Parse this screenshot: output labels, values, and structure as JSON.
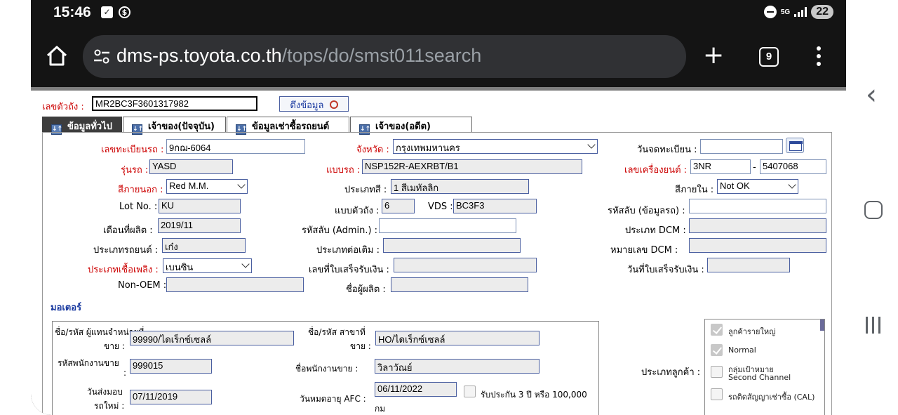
{
  "status": {
    "time": "15:46",
    "network": "5G",
    "battery": "22"
  },
  "browser": {
    "url_host": "dms-ps.toyota.co.th",
    "url_path": "/tops/do/smst011search",
    "tab_count": "9"
  },
  "header": {
    "vin_label": "เลขตัวถัง :",
    "vin_value": "MR2BC3F3601317982",
    "fetch_label": "ดึงข้อมูล"
  },
  "tabs": [
    {
      "label": "ข้อมูลทั่วไป"
    },
    {
      "label": "เจ้าของ(ปัจจุบัน)"
    },
    {
      "label": "ข้อมูลเช่าซื้อรถยนต์"
    },
    {
      "label": "เจ้าของ(อดีต)"
    }
  ],
  "fields": {
    "plate_label": "เลขทะเบียนรถ :",
    "plate_value": "9กฌ-6064",
    "province_label": "จังหวัด :",
    "province_value": "กรุงเทพมหานคร",
    "regdate_label": "วันจดทะเบียน :",
    "regdate_value": "",
    "model_label": "รุ่นรถ :",
    "model_value": "YASD",
    "type_label": "แบบรถ :",
    "type_value": "NSP152R-AEXRBT/B1",
    "engine_label": "เลขเครื่องยนต์ :",
    "engine_prefix": "3NR",
    "engine_dash": "-",
    "engine_value": "5407068",
    "extcolor_label": "สีภายนอก :",
    "extcolor_value": "Red M.M.",
    "colortype_label": "ประเภทสี :",
    "colortype_value": "1 สีเมทัลลิก",
    "intcolor_label": "สีภายใน :",
    "intcolor_value": "Not OK",
    "lot_label": "Lot No. :",
    "lot_value": "KU",
    "body_label": "แบบตัวถัง :",
    "body_value": "6",
    "vds_label": "VDS :",
    "vds_value": "BC3F3",
    "secret_label": "รหัสลับ (ข้อมูลรถ) :",
    "secret_value": "",
    "mfgmonth_label": "เดือนที่ผลิต :",
    "mfgmonth_value": "2019/11",
    "admin_label": "รหัสลับ (Admin.) :",
    "admin_value": "",
    "dcmtype_label": "ประเภท DCM :",
    "dcmtype_value": "",
    "cartype_label": "ประเภทรถยนต์ :",
    "cartype_value": "เก๋ง",
    "extension_label": "ประเภทต่อเติม :",
    "extension_value": "",
    "dcmno_label": "หมายเลข DCM :",
    "dcmno_value": "",
    "fuel_label": "ประเภทเชื้อเพลิง :",
    "fuel_value": "เบนซิน",
    "receipt_label": "เลขที่ใบเสร็จรับเงิน :",
    "receipt_value": "",
    "receiptdate_label": "วันที่ใบเสร็จรับเงิน :",
    "receiptdate_value": "",
    "nonoem_label": "Non-OEM :",
    "nonoem_value": "",
    "maker_label": "ชื่อผู้ผลิต :",
    "maker_value": ""
  },
  "motor": {
    "section_title": "มอเตอร์",
    "dealer_label_1": "ชื่อ/รหัส ผู้แทนจำหน่ายที่",
    "dealer_label_2": "ขาย :",
    "dealer_value": "99990/ไดเร็กซ์เซลล์",
    "branch_label_1": "ชื่อ/รหัส สาขาที่",
    "branch_label_2": "ขาย :",
    "branch_value": "HO/ไดเร็กซ์เซลล์",
    "staffcode_label_1": "รหัสพนักงานขาย",
    "staffcode_label_2": ":",
    "staffcode_value": "999015",
    "staffname_label": "ชื่อพนักงานขาย :",
    "staffname_value": "วิลาวัณย์",
    "delivery_label_1": "วันส่งมอบ",
    "delivery_label_2": "รถใหม่ :",
    "delivery_value": "07/11/2019",
    "afc_label": "วันหมดอายุ AFC :",
    "afc_value": "06/11/2022",
    "warranty_label": "รับประกัน 3 ปี หรือ 100,000",
    "warranty_unit": "กม",
    "customer_type_label": "ประเภทลูกค้า :"
  },
  "customer_types": [
    {
      "label": "ลูกค้ารายใหญ่",
      "label2": "",
      "checked": true
    },
    {
      "label": "Normal",
      "label2": "",
      "checked": true
    },
    {
      "label": "กลุ่มเป้าหมาย",
      "label2": "Second Channel",
      "checked": false
    },
    {
      "label": "รถติดสัญญาเช่าซื้อ (CAL)",
      "label2": "",
      "checked": false
    }
  ]
}
